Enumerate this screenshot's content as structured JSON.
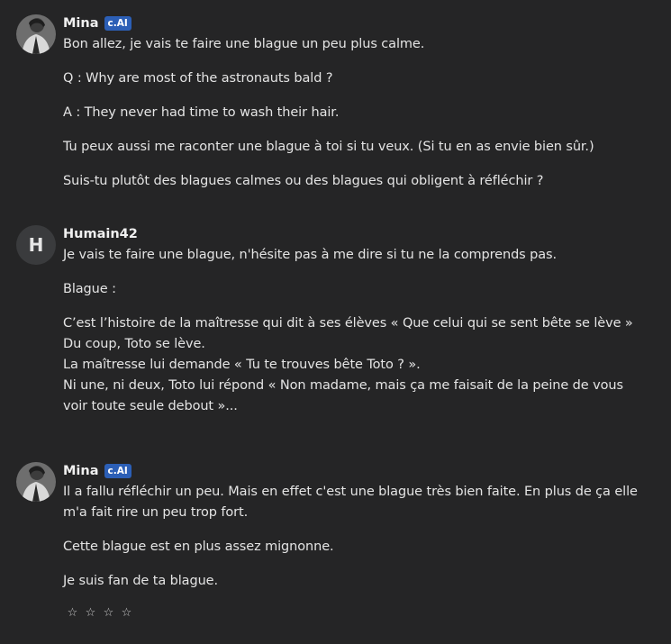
{
  "messages": [
    {
      "author": "Mina",
      "badge": "c.AI",
      "paragraphs": [
        "Bon allez, je vais te faire une blague un peu plus calme.",
        "Q : Why are most of the astronauts bald ?",
        "A : They never had time to wash their hair.",
        "Tu peux aussi me raconter une blague à toi si tu veux. (Si tu en as envie bien sûr.)",
        "Suis-tu plutôt des blagues calmes ou des blagues qui obligent à réfléchir ?"
      ]
    },
    {
      "author": "Humain42",
      "avatar_letter": "H",
      "paragraphs": [
        "Je vais te faire une blague, n'hésite pas à me dire si tu ne la comprends pas.",
        "Blague :",
        "C’est l’histoire de la maîtresse qui dit à ses élèves « Que celui qui se sent bête se lève »",
        "Du coup, Toto se lève.",
        "La maîtresse lui demande « Tu te trouves bête Toto ? ».",
        "Ni une, ni deux, Toto lui répond « Non madame, mais ça me faisait de la peine de vous",
        "voir toute seule debout »..."
      ]
    },
    {
      "author": "Mina",
      "badge": "c.AI",
      "paragraphs": [
        "Il a fallu réfléchir un peu. Mais en effet c'est une blague très bien faite. En plus de ça elle",
        "m'a fait rire un peu trop fort.",
        "Cette blague est en plus assez mignonne.",
        "Je suis fan de ta blague."
      ],
      "rating": {
        "stars": [
          "☆",
          "☆",
          "☆",
          "☆"
        ],
        "value": 0,
        "max": 4
      }
    }
  ],
  "icons": {
    "avatar_mina": "person-photo-icon",
    "star": "star-outline-icon"
  },
  "colors": {
    "background": "#252526",
    "badge": "#2c5fb6",
    "text": "#e4e4e4"
  }
}
